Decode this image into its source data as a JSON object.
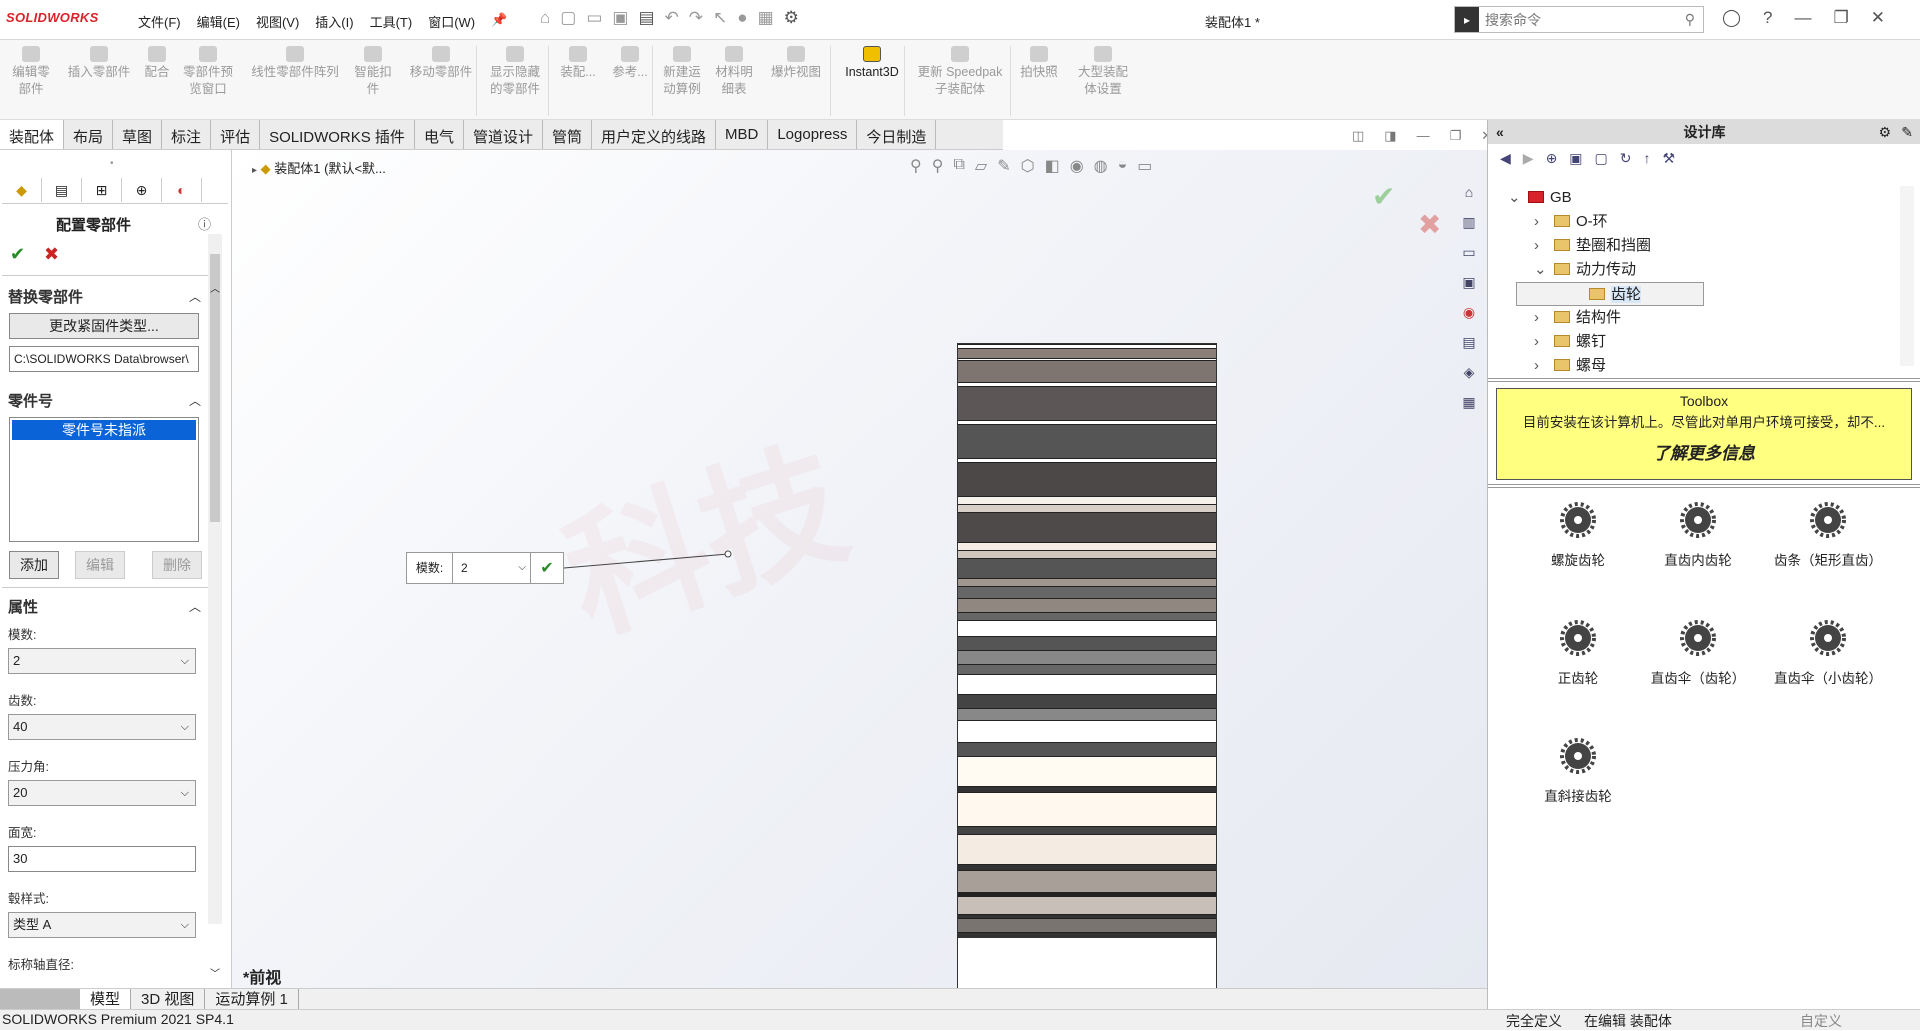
{
  "app": {
    "logo": "SOLIDWORKS",
    "menu": [
      "文件(F)",
      "编辑(E)",
      "视图(V)",
      "插入(I)",
      "工具(T)",
      "窗口(W)"
    ],
    "doc_title": "装配体1 *",
    "search_placeholder": "搜索命令"
  },
  "commands": [
    {
      "label": "编辑零\n部件",
      "on": false
    },
    {
      "label": "插入零部件",
      "on": false
    },
    {
      "label": "配合",
      "on": false
    },
    {
      "label": "零部件预\n览窗口",
      "on": false
    },
    {
      "label": "线性零部件阵列",
      "on": false
    },
    {
      "label": "智能扣\n件",
      "on": false
    },
    {
      "label": "移动零部件",
      "on": false
    },
    {
      "label": "显示隐藏\n的零部件",
      "on": false
    },
    {
      "label": "装配...",
      "on": false
    },
    {
      "label": "参考...",
      "on": false
    },
    {
      "label": "新建运\n动算例",
      "on": false
    },
    {
      "label": "材料明\n细表",
      "on": false
    },
    {
      "label": "爆炸视图",
      "on": false
    },
    {
      "label": "Instant3D",
      "on": true
    },
    {
      "label": "更新 Speedpak\n子装配体",
      "on": false
    },
    {
      "label": "拍快照",
      "on": false
    },
    {
      "label": "大型装配\n体设置",
      "on": false
    }
  ],
  "tabs": [
    "装配体",
    "布局",
    "草图",
    "标注",
    "评估",
    "SOLIDWORKS 插件",
    "电气",
    "管道设计",
    "管筒",
    "用户定义的线路",
    "MBD",
    "Logopress",
    "今日制造"
  ],
  "left": {
    "title": "配置零部件",
    "sec_replace": "替换零部件",
    "btn_change": "更改紧固件类型...",
    "path": "C:\\SOLIDWORKS Data\\browser\\",
    "sec_partno": "零件号",
    "partno_item": "零件号未指派",
    "btn_add": "添加",
    "btn_edit": "编辑",
    "btn_delete": "删除",
    "sec_props": "属性",
    "module_label": "模数:",
    "module_value": "2",
    "teeth_label": "齿数:",
    "teeth_value": "40",
    "pressure_label": "压力角:",
    "pressure_value": "20",
    "face_label": "面宽:",
    "face_value": "30",
    "hub_label": "毂样式:",
    "hub_value": "类型 A",
    "shaft_label": "标称轴直径:"
  },
  "viewport": {
    "tree_node": "装配体1  (默认<默...",
    "callout_key": "模数:",
    "callout_value": "2",
    "view_label": "*前视",
    "watermark": "科技"
  },
  "bottom_tabs": [
    "模型",
    "3D 视图",
    "运动算例 1"
  ],
  "status": {
    "left": "SOLIDWORKS Premium 2021 SP4.1",
    "defined": "完全定义",
    "editing": "在编辑 装配体",
    "custom": "自定义"
  },
  "design_library": {
    "title": "设计库",
    "tree": [
      {
        "label": "GB",
        "level": 0,
        "chev": "⌄"
      },
      {
        "label": "O-环",
        "level": 1,
        "chev": "›"
      },
      {
        "label": "垫圈和挡圈",
        "level": 1,
        "chev": "›"
      },
      {
        "label": "动力传动",
        "level": 1,
        "chev": "⌄"
      },
      {
        "label": "齿轮",
        "level": 2,
        "chev": "",
        "selected": true
      },
      {
        "label": "结构件",
        "level": 1,
        "chev": "›"
      },
      {
        "label": "螺钉",
        "level": 1,
        "chev": "›"
      },
      {
        "label": "螺母",
        "level": 1,
        "chev": "›"
      }
    ],
    "toolbox_title": "Toolbox",
    "toolbox_desc": "目前安装在该计算机上。尽管此对单用户环境可接受，却不...",
    "toolbox_more": "了解更多信息",
    "palette": [
      "螺旋齿轮",
      "直齿内齿轮",
      "齿条（矩形直齿）",
      "正齿轮",
      "直齿伞（齿轮）",
      "直齿伞（小齿轮）",
      "直斜接齿轮"
    ]
  },
  "colors": {
    "accent_red": "#d8232a",
    "toolbox_yellow": "#ffff80",
    "selection_blue": "#0a64d8"
  }
}
